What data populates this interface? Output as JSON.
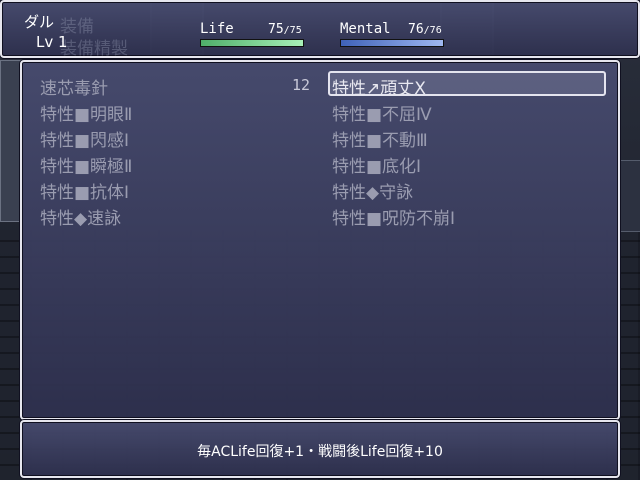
{
  "status": {
    "name": "ダル",
    "level": "Lv 1",
    "ghost_menu": [
      "装備",
      "装備精製"
    ],
    "life": {
      "label": "Life",
      "current": "75",
      "max": "/75",
      "ratio": 1.0,
      "color_start": "#4fae6a",
      "color_end": "#a8f0b8"
    },
    "mental": {
      "label": "Mental",
      "current": "76",
      "max": "/76",
      "ratio": 1.0,
      "color_start": "#3f62b8",
      "color_end": "#9fb8f0"
    }
  },
  "skill_list": {
    "left": [
      {
        "label": "速芯毒針",
        "count": "12"
      },
      {
        "label": "特性■明眼Ⅱ"
      },
      {
        "label": "特性■閃感Ⅰ"
      },
      {
        "label": "特性■瞬極Ⅱ"
      },
      {
        "label": "特性■抗体Ⅰ"
      },
      {
        "label": "特性◆速詠"
      }
    ],
    "right": [
      {
        "label": "特性↗頑丈Ⅹ",
        "selected": true
      },
      {
        "label": "特性■不屈Ⅳ"
      },
      {
        "label": "特性■不動Ⅲ"
      },
      {
        "label": "特性■底化Ⅰ"
      },
      {
        "label": "特性◆守詠"
      },
      {
        "label": "特性■呪防不崩Ⅰ"
      }
    ]
  },
  "help": {
    "text": "毎ACLife回復+1・戦闘後Life回復+10"
  }
}
